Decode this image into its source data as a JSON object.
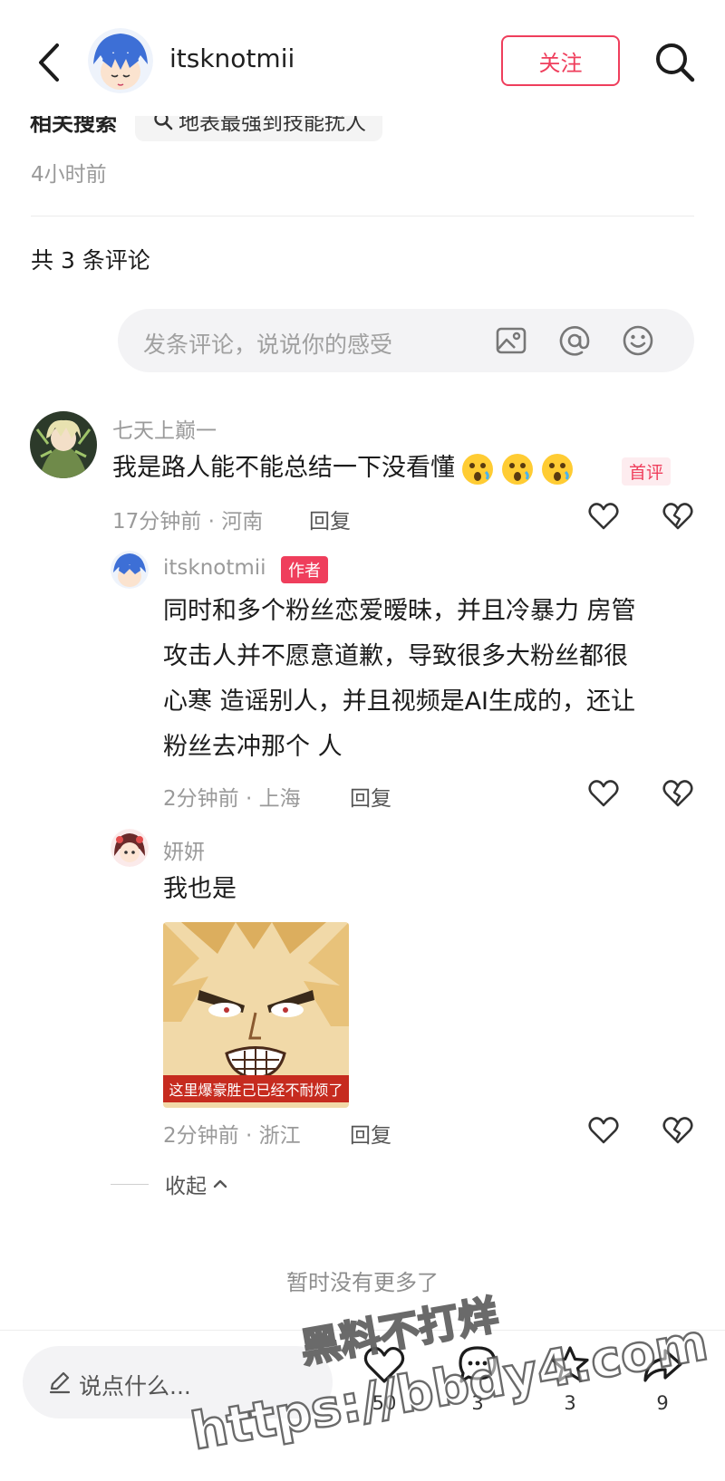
{
  "header": {
    "username": "itsknotmii",
    "follow_label": "关注"
  },
  "related": {
    "label": "相关搜索",
    "query": "地表最强到技能扰人"
  },
  "post": {
    "time": "4小时前"
  },
  "comments_header": {
    "count_label": "共 3 条评论"
  },
  "comment_input": {
    "placeholder": "发条评论，说说你的感受"
  },
  "comments": [
    {
      "username": "七天上巅一",
      "text": "我是路人能不能总结一下没看懂",
      "badge": "首评",
      "time": "17分钟前 · 河南",
      "reply_label": "回复"
    }
  ],
  "replies": [
    {
      "username": "itsknotmii",
      "badge": "作者",
      "lines": [
        "同时和多个粉丝恋爱暧昧，并且冷暴力 房管",
        "攻击人并不愿意道歉，导致很多大粉丝都很",
        "心寒 造谣别人，并且视频是AI生成的，还让",
        "粉丝去冲那个 人"
      ],
      "time": "2分钟前 · 上海",
      "reply_label": "回复"
    },
    {
      "username": "妍妍",
      "text": "我也是",
      "sticker_caption": "这里爆豪胜己已经不耐烦了",
      "time": "2分钟前 · 浙江",
      "reply_label": "回复"
    }
  ],
  "collapse_label": "收起",
  "no_more_label": "暂时没有更多了",
  "bottom_bar": {
    "placeholder": "说点什么...",
    "like_count": "50",
    "comment_count": "3",
    "star_count": "3",
    "share_count": "9"
  },
  "watermark": {
    "line1": "黑料不打烊",
    "line2": "https://bbdy4.com"
  },
  "colors": {
    "accent": "#ef3e5c",
    "muted_text": "#9a9a9a"
  }
}
